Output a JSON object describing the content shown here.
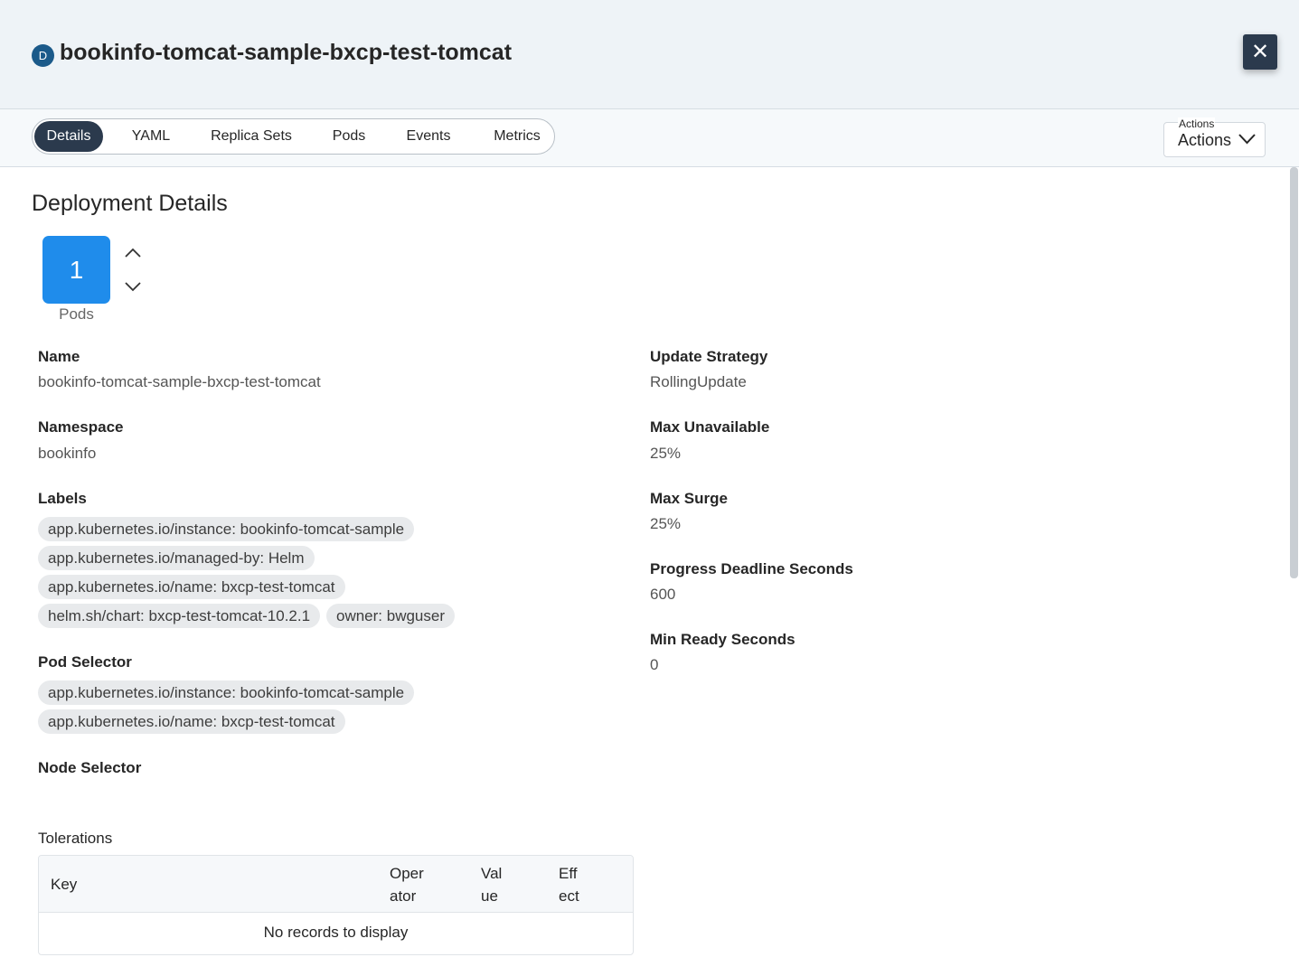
{
  "header": {
    "kind_badge": "D",
    "title": "bookinfo-tomcat-sample-bxcp-test-tomcat",
    "close_icon": "close-icon"
  },
  "tabs": [
    {
      "label": "Details",
      "active": true
    },
    {
      "label": "YAML",
      "active": false
    },
    {
      "label": "Replica Sets",
      "active": false
    },
    {
      "label": "Pods",
      "active": false
    },
    {
      "label": "Events",
      "active": false
    },
    {
      "label": "Metrics",
      "active": false
    }
  ],
  "actions": {
    "legend": "Actions",
    "value": "Actions",
    "icon": "chevron-down-icon"
  },
  "section_title": "Deployment Details",
  "pods": {
    "count": "1",
    "label": "Pods",
    "increase_icon": "chevron-up-icon",
    "decrease_icon": "chevron-down-icon"
  },
  "left": {
    "name": {
      "label": "Name",
      "value": "bookinfo-tomcat-sample-bxcp-test-tomcat"
    },
    "namespace": {
      "label": "Namespace",
      "value": "bookinfo"
    },
    "labels": {
      "label": "Labels",
      "chips": [
        "app.kubernetes.io/instance: bookinfo-tomcat-sample",
        "app.kubernetes.io/managed-by: Helm",
        "app.kubernetes.io/name: bxcp-test-tomcat",
        "helm.sh/chart: bxcp-test-tomcat-10.2.1",
        "owner: bwguser"
      ]
    },
    "pod_selector": {
      "label": "Pod Selector",
      "chips": [
        "app.kubernetes.io/instance: bookinfo-tomcat-sample",
        "app.kubernetes.io/name: bxcp-test-tomcat"
      ]
    },
    "node_selector": {
      "label": "Node Selector"
    },
    "tolerations": {
      "label": "Tolerations",
      "columns": [
        {
          "line1": "Key",
          "line2": ""
        },
        {
          "line1": "Oper",
          "line2": "ator"
        },
        {
          "line1": "Val",
          "line2": "ue"
        },
        {
          "line1": "Eff",
          "line2": "ect"
        }
      ],
      "empty_text": "No records to display"
    }
  },
  "right": {
    "update_strategy": {
      "label": "Update Strategy",
      "value": "RollingUpdate"
    },
    "max_unavailable": {
      "label": "Max Unavailable",
      "value": "25%"
    },
    "max_surge": {
      "label": "Max Surge",
      "value": "25%"
    },
    "progress_deadline": {
      "label": "Progress Deadline Seconds",
      "value": "600"
    },
    "min_ready": {
      "label": "Min Ready Seconds",
      "value": "0"
    }
  },
  "colors": {
    "accent": "#1f8ceb",
    "dark": "#2b3a4d",
    "header_bg": "#eef3f7",
    "badge": "#1b5a8a"
  }
}
